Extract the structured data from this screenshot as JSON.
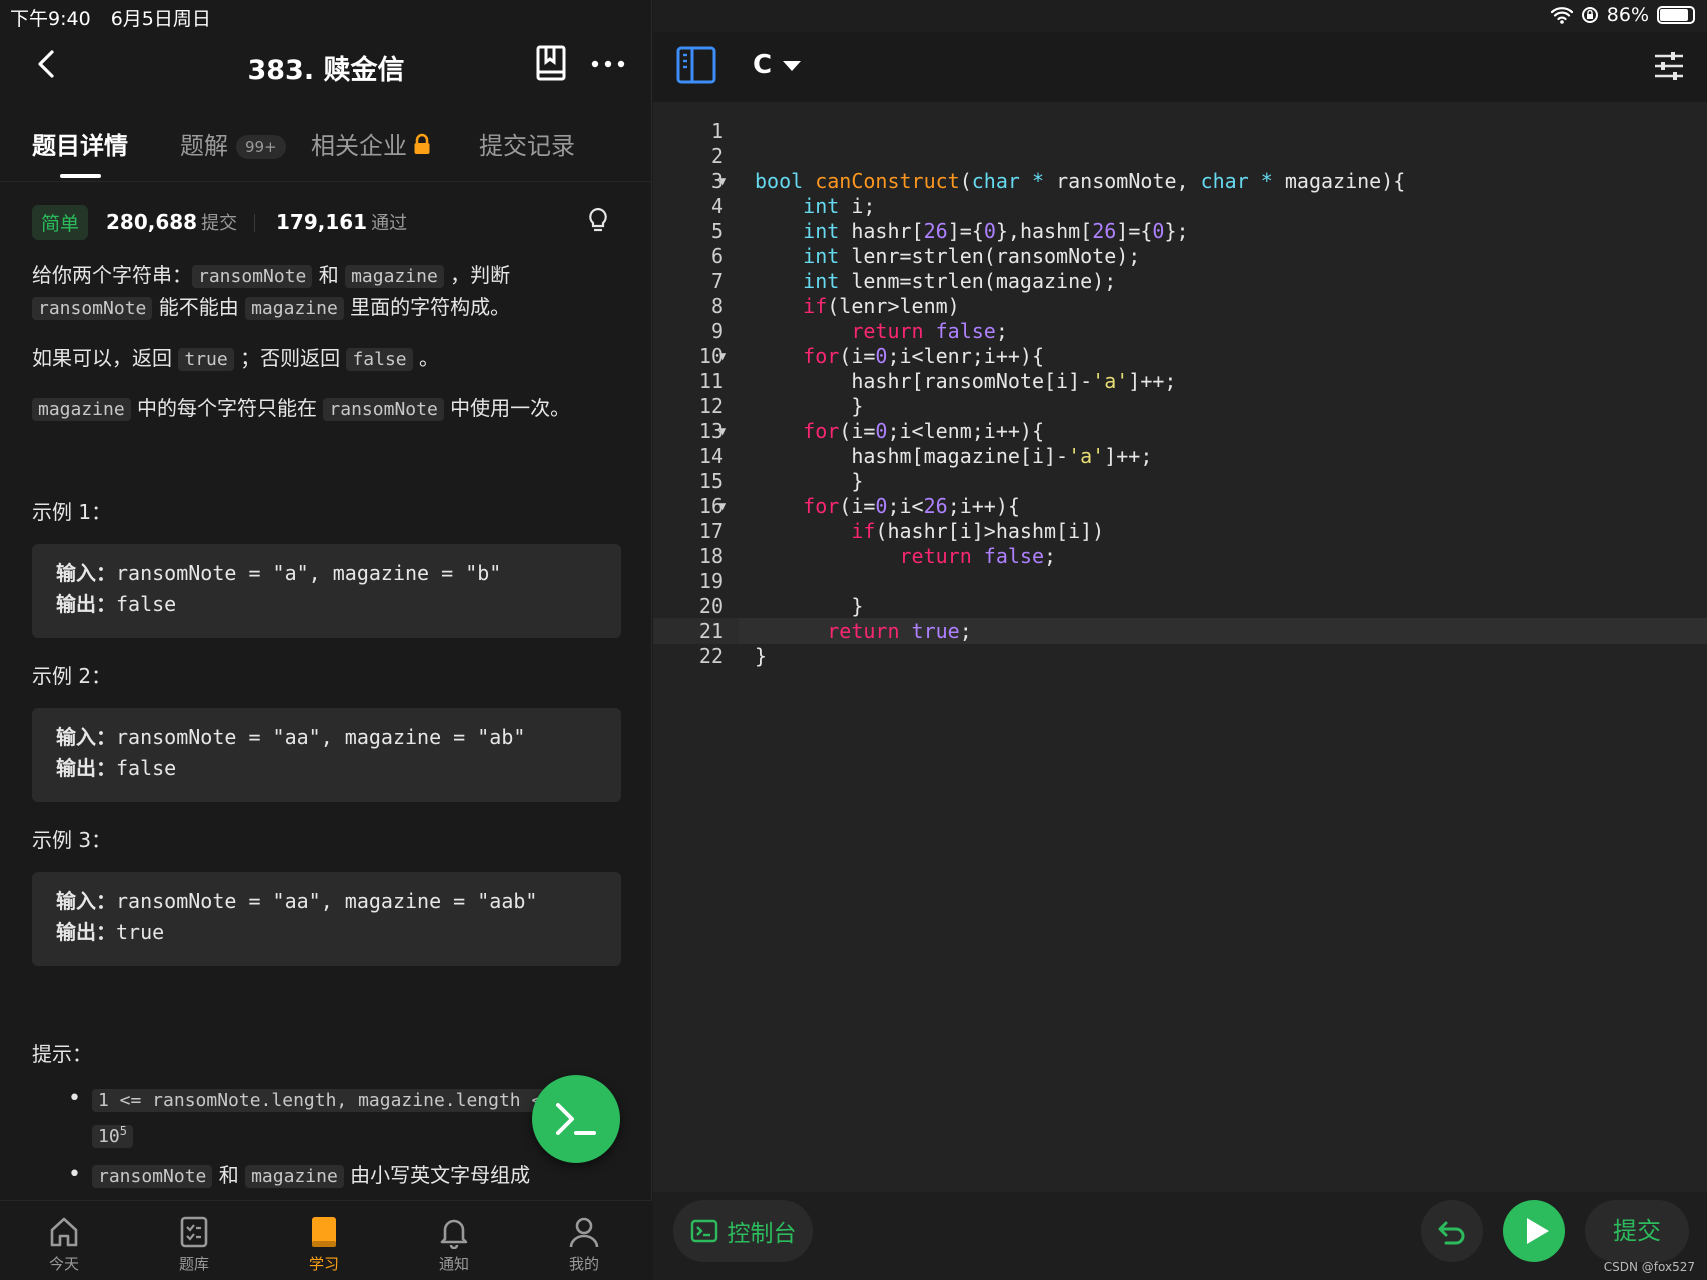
{
  "status": {
    "time": "下午9:40",
    "date": "6月5日周日",
    "battery": "86%",
    "battery_level": 0.86
  },
  "problem": {
    "title": "383. 赎金信",
    "tabs": [
      {
        "label": "题目详情"
      },
      {
        "label": "题解",
        "badge": "99+"
      },
      {
        "label": "相关企业"
      },
      {
        "label": "提交记录"
      }
    ],
    "difficulty": "简单",
    "submissions": "280,688",
    "submissions_label": "提交",
    "accepted": "179,161",
    "accepted_label": "通过",
    "desc": {
      "p1_a": "给你两个字符串：",
      "p1_code1": "ransomNote",
      "p1_b": " 和 ",
      "p1_code2": "magazine",
      "p1_c": " ，判断",
      "p1_code3": "ransomNote",
      "p1_d": " 能不能由 ",
      "p1_code4": "magazine",
      "p1_e": " 里面的字符构成。",
      "p2_a": "如果可以，返回 ",
      "p2_code1": "true",
      "p2_b": " ；否则返回 ",
      "p2_code2": "false",
      "p2_c": " 。",
      "p3_code1": "magazine",
      "p3_a": " 中的每个字符只能在 ",
      "p3_code2": "ransomNote",
      "p3_b": " 中使用一次。"
    },
    "examples": [
      {
        "title": "示例 1：",
        "input_label": "输入：",
        "input": "ransomNote = \"a\", magazine = \"b\"",
        "output_label": "输出：",
        "output": "false"
      },
      {
        "title": "示例 2：",
        "input_label": "输入：",
        "input": "ransomNote = \"aa\", magazine = \"ab\"",
        "output_label": "输出：",
        "output": "false"
      },
      {
        "title": "示例 3：",
        "input_label": "输入：",
        "input": "ransomNote = \"aa\", magazine = \"aab\"",
        "output_label": "输出：",
        "output": "true"
      }
    ],
    "hints_title": "提示：",
    "hint1_code": "1 <= ransomNote.length, magazine.length <=",
    "hint1_exp_base": "10",
    "hint1_exp_pow": "5",
    "hint2_code1": "ransomNote",
    "hint2_a": " 和 ",
    "hint2_code2": "magazine",
    "hint2_b": " 由小写英文字母组成"
  },
  "nav": [
    {
      "label": "今天",
      "icon": "home-icon"
    },
    {
      "label": "题库",
      "icon": "checklist-icon"
    },
    {
      "label": "学习",
      "icon": "book-icon"
    },
    {
      "label": "通知",
      "icon": "bell-icon"
    },
    {
      "label": "我的",
      "icon": "user-icon"
    }
  ],
  "editor": {
    "language": "C",
    "current_line": 21,
    "console_label": "控制台",
    "submit_label": "提交",
    "watermark": "CSDN @fox527"
  },
  "colors": {
    "accent_green": "#2cbb5d",
    "accent_orange": "#ffa116",
    "background": "#1a1a1a"
  }
}
